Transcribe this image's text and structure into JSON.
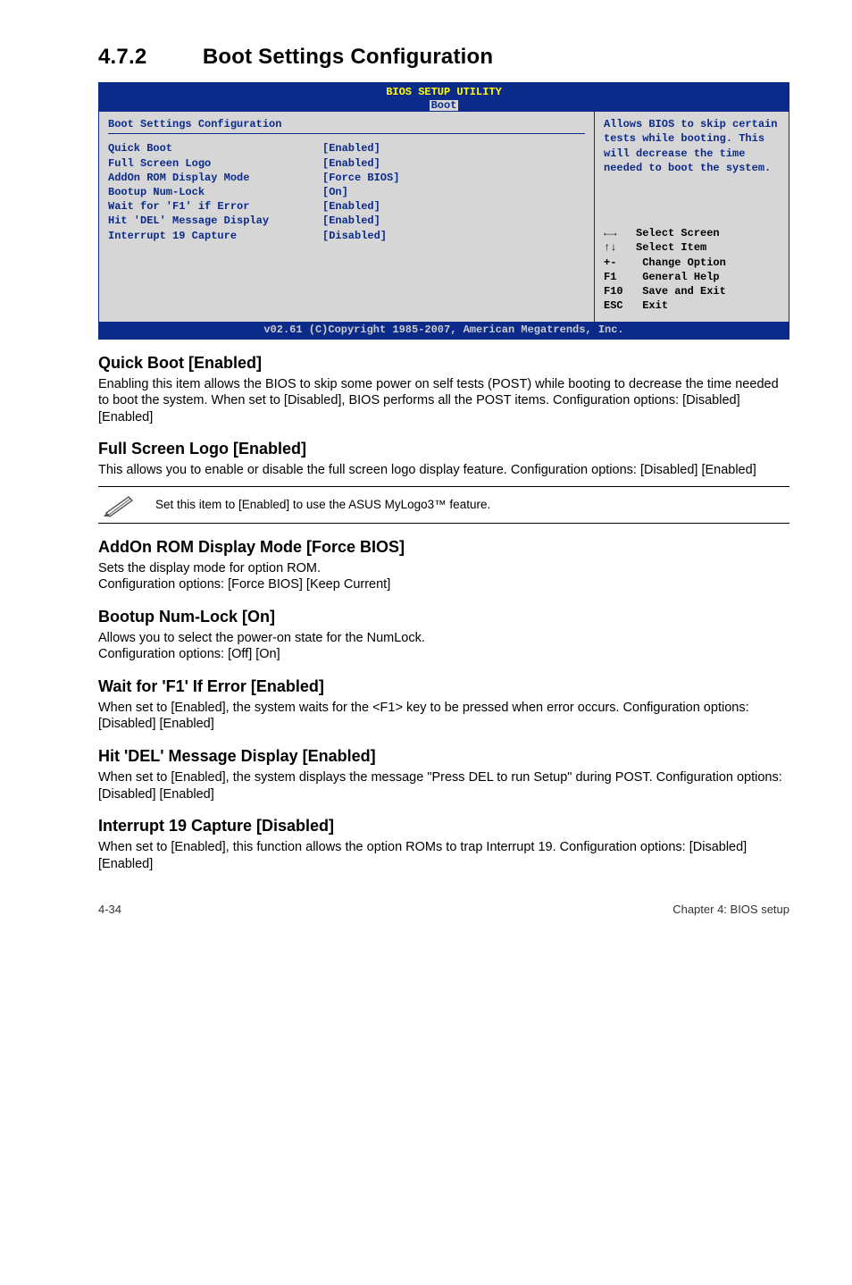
{
  "section": {
    "number": "4.7.2",
    "title": "Boot Settings Configuration"
  },
  "bios": {
    "header_title": "BIOS SETUP UTILITY",
    "tab": "Boot",
    "panel_title": "Boot Settings Configuration",
    "settings": [
      {
        "label": "Quick Boot",
        "value": "[Enabled]"
      },
      {
        "label": "Full Screen Logo",
        "value": "[Enabled]"
      },
      {
        "label": "AddOn ROM Display Mode",
        "value": "[Force BIOS]"
      },
      {
        "label": "Bootup Num-Lock",
        "value": "[On]"
      },
      {
        "label": "Wait for 'F1' if Error",
        "value": "[Enabled]"
      },
      {
        "label": "Hit 'DEL' Message Display",
        "value": "[Enabled]"
      },
      {
        "label": "Interrupt 19 Capture",
        "value": "[Disabled]"
      }
    ],
    "help_text": "Allows BIOS to skip certain tests while booting. This will decrease the time needed to boot the system.",
    "keys": [
      {
        "k": "←→ ",
        "d": "Select Screen"
      },
      {
        "k": "↑↓ ",
        "d": "Select Item"
      },
      {
        "k": "+-  ",
        "d": "Change Option"
      },
      {
        "k": "F1  ",
        "d": "General Help"
      },
      {
        "k": "F10 ",
        "d": "Save and Exit"
      },
      {
        "k": "ESC ",
        "d": "Exit"
      }
    ],
    "footer": "v02.61 (C)Copyright 1985-2007, American Megatrends, Inc."
  },
  "quickboot": {
    "heading": "Quick Boot [Enabled]",
    "body": "Enabling this item allows the BIOS to skip some power on self tests (POST) while booting to decrease the time needed to boot the system. When set to [Disabled], BIOS performs all the POST items. Configuration options: [Disabled] [Enabled]"
  },
  "fullscreen": {
    "heading": "Full Screen Logo [Enabled]",
    "body": "This allows you to enable or disable the full screen logo display feature. Configuration options: [Disabled] [Enabled]"
  },
  "note": {
    "text": "Set this item to [Enabled] to use the ASUS MyLogo3™ feature."
  },
  "addon": {
    "heading": "AddOn ROM Display Mode [Force BIOS]",
    "body": "Sets the display mode for option ROM.\nConfiguration options: [Force BIOS] [Keep Current]"
  },
  "numlock": {
    "heading": "Bootup Num-Lock [On]",
    "body": "Allows you to select the power-on state for the NumLock.\nConfiguration options: [Off] [On]"
  },
  "waitf1": {
    "heading": "Wait for 'F1' If Error [Enabled]",
    "body": "When set to [Enabled], the system waits for the <F1> key to be pressed when error occurs. Configuration options: [Disabled] [Enabled]"
  },
  "hitdel": {
    "heading": "Hit 'DEL' Message Display [Enabled]",
    "body": "When set to [Enabled], the system displays the message \"Press DEL to run Setup\" during POST. Configuration options: [Disabled] [Enabled]"
  },
  "int19": {
    "heading": "Interrupt 19 Capture [Disabled]",
    "body": "When set to [Enabled], this function allows the option ROMs to trap Interrupt 19. Configuration options: [Disabled] [Enabled]"
  },
  "footer": {
    "left": "4-34",
    "right": "Chapter 4: BIOS setup"
  }
}
